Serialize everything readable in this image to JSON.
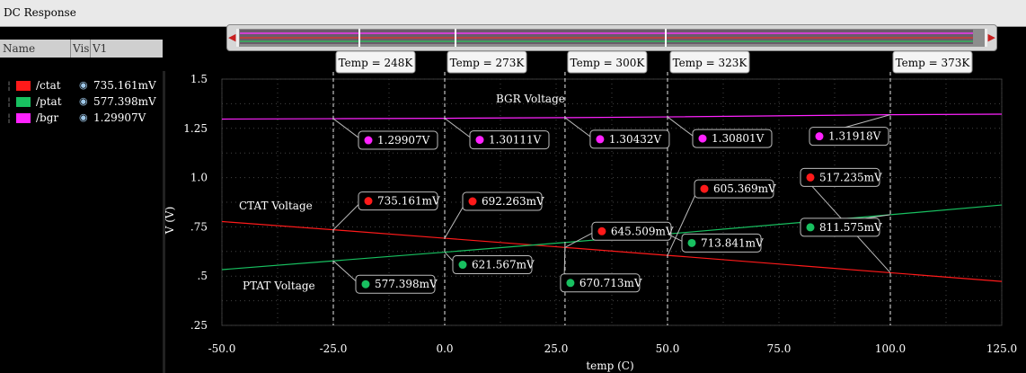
{
  "window": {
    "title": "DC Response"
  },
  "panel": {
    "headers": [
      "Name",
      "Vis",
      "V1"
    ],
    "traces": [
      {
        "name": "/ctat",
        "color": "#ff1a1a",
        "value": "735.161mV"
      },
      {
        "name": "/ptat",
        "color": "#18c060",
        "value": "577.398mV"
      },
      {
        "name": "/bgr",
        "color": "#ff22ff",
        "value": "1.29907V"
      }
    ]
  },
  "chart_data": {
    "type": "line",
    "xlabel": "temp (C)",
    "ylabel": "V (V)",
    "xlim": [
      -50,
      125
    ],
    "ylim": [
      0.25,
      1.5
    ],
    "xticks": [
      "-50.0",
      "-25.0",
      "0.0",
      "25.0",
      "50.0",
      "75.0",
      "100.0",
      "125.0"
    ],
    "yticks": [
      ".25",
      ".5",
      ".75",
      "1.0",
      "1.25",
      "1.5"
    ],
    "grid": true,
    "series": [
      {
        "name": "/ctat",
        "color": "#ff1a1a",
        "x": [
          -50,
          -25,
          0,
          27,
          50,
          100,
          125
        ],
        "y": [
          0.777,
          0.735161,
          0.692263,
          0.645509,
          0.605369,
          0.517235,
          0.473
        ]
      },
      {
        "name": "/ptat",
        "color": "#18c060",
        "x": [
          -50,
          -25,
          0,
          27,
          50,
          100,
          125
        ],
        "y": [
          0.533,
          0.577398,
          0.621567,
          0.670713,
          0.713841,
          0.811575,
          0.861
        ]
      },
      {
        "name": "/bgr",
        "color": "#ff22ff",
        "x": [
          -50,
          -25,
          0,
          27,
          50,
          100,
          125
        ],
        "y": [
          1.2971,
          1.29907,
          1.30111,
          1.30432,
          1.30801,
          1.31918,
          1.3222
        ]
      }
    ],
    "markers": [
      {
        "label": "Temp = 248K",
        "x": -25
      },
      {
        "label": "Temp = 273K",
        "x": 0
      },
      {
        "label": "Temp = 300K",
        "x": 27
      },
      {
        "label": "Temp = 323K",
        "x": 50
      },
      {
        "label": "Temp = 373K",
        "x": 100
      }
    ],
    "point_labels": [
      {
        "text": "1.29907V",
        "color": "#ff22ff",
        "x": -25,
        "y": 1.29907
      },
      {
        "text": "1.30111V",
        "color": "#ff22ff",
        "x": 0,
        "y": 1.30111
      },
      {
        "text": "1.30432V",
        "color": "#ff22ff",
        "x": 27,
        "y": 1.30432
      },
      {
        "text": "1.30801V",
        "color": "#ff22ff",
        "x": 50,
        "y": 1.30801
      },
      {
        "text": "1.31918V",
        "color": "#ff22ff",
        "x": 100,
        "y": 1.31918
      },
      {
        "text": "735.161mV",
        "color": "#ff1a1a",
        "x": -25,
        "y": 0.735161
      },
      {
        "text": "692.263mV",
        "color": "#ff1a1a",
        "x": 0,
        "y": 0.692263
      },
      {
        "text": "645.509mV",
        "color": "#ff1a1a",
        "x": 27,
        "y": 0.645509
      },
      {
        "text": "605.369mV",
        "color": "#ff1a1a",
        "x": 50,
        "y": 0.605369
      },
      {
        "text": "517.235mV",
        "color": "#ff1a1a",
        "x": 100,
        "y": 0.517235
      },
      {
        "text": "577.398mV",
        "color": "#18c060",
        "x": -25,
        "y": 0.577398
      },
      {
        "text": "621.567mV",
        "color": "#18c060",
        "x": 0,
        "y": 0.621567
      },
      {
        "text": "670.713mV",
        "color": "#18c060",
        "x": 27,
        "y": 0.670713
      },
      {
        "text": "713.841mV",
        "color": "#18c060",
        "x": 50,
        "y": 0.713841
      },
      {
        "text": "811.575mV",
        "color": "#18c060",
        "x": 100,
        "y": 0.811575
      }
    ],
    "annotations": [
      "BGR Voltage",
      "CTAT Voltage",
      "PTAT Voltage"
    ]
  }
}
